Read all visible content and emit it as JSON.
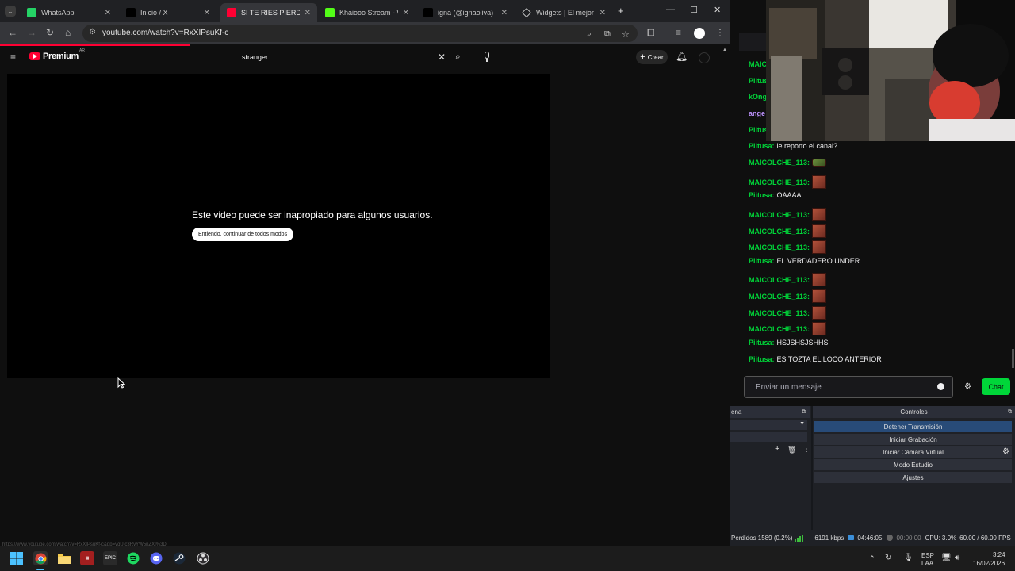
{
  "browser": {
    "tabs": [
      {
        "label": "WhatsApp",
        "icon": "whatsapp-icon",
        "color": "#25d366"
      },
      {
        "label": "Inicio / X",
        "icon": "x-icon",
        "color": "#000000"
      },
      {
        "label": "SI TE RIES PIERDES C",
        "icon": "youtube-icon",
        "color": "#ff0033",
        "active": true
      },
      {
        "label": "Khaiooo Stream - Wa",
        "icon": "kick-icon",
        "color": "#53fc18"
      },
      {
        "label": "igna (@ignaoliva) | Ti",
        "icon": "tiktok-icon",
        "color": "#000000"
      },
      {
        "label": "Widgets | El mejor so",
        "icon": "widget-icon",
        "color": "#ffffff"
      }
    ],
    "url": "youtube.com/watch?v=RxXIPsuKf-c"
  },
  "youtube": {
    "logo_text": "Premium",
    "country_code": "AR",
    "search_query": "stranger",
    "create_label": "Crear",
    "warning_text": "Este video puede ser inapropiado para algunos usuarios.",
    "continue_label": "Entiendo, continuar de todos modos",
    "status_url": "https://www.youtube.com/watch?v=RxXIPsuKf-c&pp=ygUIc3RyYW5nZXI%3D"
  },
  "chat": {
    "messages": [
      {
        "user": "MAIC",
        "text": "",
        "color": "#00d639",
        "emote": ""
      },
      {
        "user": "Piitus",
        "text": "",
        "color": "#00d639",
        "emote": ""
      },
      {
        "user": "kOng",
        "text": "",
        "color": "#00d639",
        "emote": ""
      },
      {
        "user": "ange",
        "text": "",
        "color": "#bf94ff",
        "emote": ""
      },
      {
        "user": "Piitus",
        "text": "",
        "color": "#00d639",
        "emote": ""
      },
      {
        "user": "Piitusa:",
        "text": "le reporto el canal?",
        "color": "#00d639",
        "emote": ""
      },
      {
        "user": "MAICOLCHE_113:",
        "text": "",
        "color": "#00d639",
        "emote": "frog"
      },
      {
        "user": "MAICOLCHE_113:",
        "text": "",
        "color": "#00d639",
        "emote": "face"
      },
      {
        "user": "Piitusa:",
        "text": "OAAAA",
        "color": "#00d639",
        "emote": ""
      },
      {
        "user": "MAICOLCHE_113:",
        "text": "",
        "color": "#00d639",
        "emote": "face"
      },
      {
        "user": "MAICOLCHE_113:",
        "text": "",
        "color": "#00d639",
        "emote": "face"
      },
      {
        "user": "MAICOLCHE_113:",
        "text": "",
        "color": "#00d639",
        "emote": "face"
      },
      {
        "user": "Piitusa:",
        "text": "EL VERDADERO UNDER",
        "color": "#00d639",
        "emote": ""
      },
      {
        "user": "MAICOLCHE_113:",
        "text": "",
        "color": "#00d639",
        "emote": "face"
      },
      {
        "user": "MAICOLCHE_113:",
        "text": "",
        "color": "#00d639",
        "emote": "face"
      },
      {
        "user": "MAICOLCHE_113:",
        "text": "",
        "color": "#00d639",
        "emote": "face"
      },
      {
        "user": "MAICOLCHE_113:",
        "text": "",
        "color": "#00d639",
        "emote": "face"
      },
      {
        "user": "Piitusa:",
        "text": "HSJSHSJSHHS",
        "color": "#00d639",
        "emote": ""
      },
      {
        "user": "Piitusa:",
        "text": "ES TOZTA EL LOCO ANTERIOR",
        "color": "#00d639",
        "emote": ""
      }
    ],
    "input_placeholder": "Enviar un mensaje",
    "send_label": "Chat"
  },
  "obs": {
    "scenes_header": "ena",
    "controls_header": "Controles",
    "controls": [
      {
        "label": "Detener Transmisión",
        "active": true
      },
      {
        "label": "Iniciar Grabación",
        "active": false
      },
      {
        "label": "Iniciar Cámara Virtual",
        "active": false
      },
      {
        "label": "Modo Estudio",
        "active": false
      },
      {
        "label": "Ajustes",
        "active": false
      }
    ],
    "status": {
      "dropped": "Perdidos 1589 (0.2%)",
      "bitrate": "6191 kbps",
      "stream_time": "04:46:05",
      "rec_time": "00:00:00",
      "cpu": "CPU: 3.0%",
      "fps": "60.00 / 60.00 FPS"
    }
  },
  "taskbar": {
    "language": "ESP",
    "layout": "LAA",
    "time": "3:24",
    "date": "16/02/2026"
  }
}
